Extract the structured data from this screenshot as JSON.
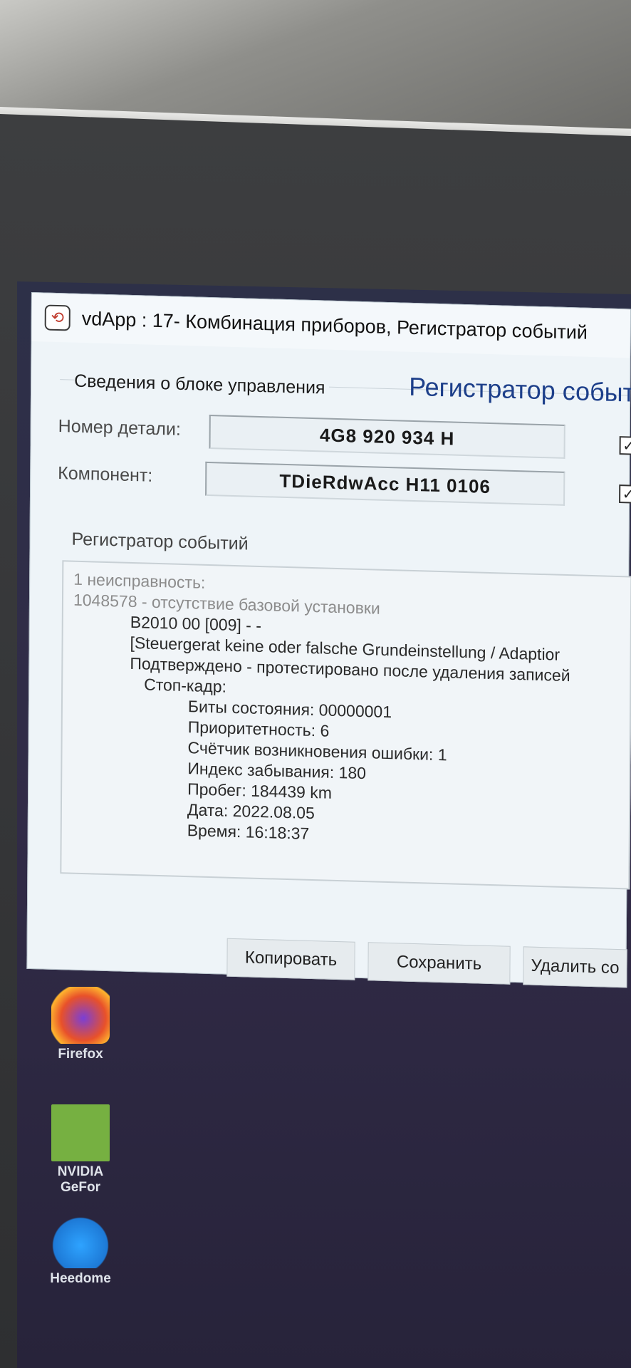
{
  "window": {
    "title": "vdApp : 17- Комбинация приборов,  Регистратор событий",
    "panel_title": "Регистратор событи"
  },
  "control_unit": {
    "group_label": "Сведения о блоке управления",
    "part_number_label": "Номер детали:",
    "part_number_value": "4G8 920 934 H",
    "component_label": "Компонент:",
    "component_value": "TDieRdwAcc    H11 0106"
  },
  "event_log": {
    "section_label": "Регистратор событий",
    "lines": [
      "1 неисправность:",
      "1048578 - отсутствие базовой установки",
      "B2010 00 [009] - -",
      "[Steuergerat keine oder falsche Grundeinstellung / Adaptior",
      "Подтверждено - протестировано после удаления записей",
      "Стоп-кадр:",
      "Биты состояния: 00000001",
      "Приоритетность: 6",
      "Счётчик возникновения ошибки: 1",
      "Индекс забывания: 180",
      "Пробег: 184439 km",
      "Дата: 2022.08.05",
      "Время: 16:18:37"
    ]
  },
  "buttons": {
    "copy": "Копировать",
    "save": "Сохранить",
    "delete": "Удалить со"
  },
  "desktop": {
    "icons": [
      {
        "label": "Firefox",
        "icon": "firefox-icon"
      },
      {
        "label": "NVIDIA GeFor",
        "icon": "nvidia-icon"
      },
      {
        "label": "Heedome",
        "icon": "heedome-icon"
      }
    ]
  }
}
